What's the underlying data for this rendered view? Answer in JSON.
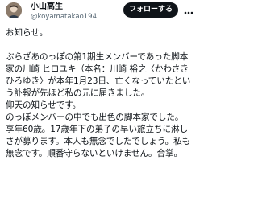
{
  "author": {
    "name": "小山高生",
    "handle": "@koyamatakao194",
    "avatar_icon": "profile-photo"
  },
  "follow_button": {
    "label": "フォローする",
    "background": "#0f1419",
    "color": "#ffffff"
  },
  "more_button": {
    "icon": "more-horizontal-icon"
  },
  "post": {
    "text": "お知らせ。\n\nぶらざあのっぽの第1期生メンバーであった脚本家の川崎 ヒロユキ（本名：川崎 裕之〈かわさき ひろゆき〉が本年1月23日、亡くなっていたという訃報が先ほど私の元に届きました。\n仰天の知らせです。\nのっぽメンバーの中でも出色の脚本家でした。\n享年60歳。17歳年下の弟子の早い旅立ちに淋しさが募ります。本人も無念でしたでしょう。私も無念です。順番守らないといけません。合掌。"
  },
  "colors": {
    "text": "#0f1419",
    "secondary": "#536471"
  }
}
